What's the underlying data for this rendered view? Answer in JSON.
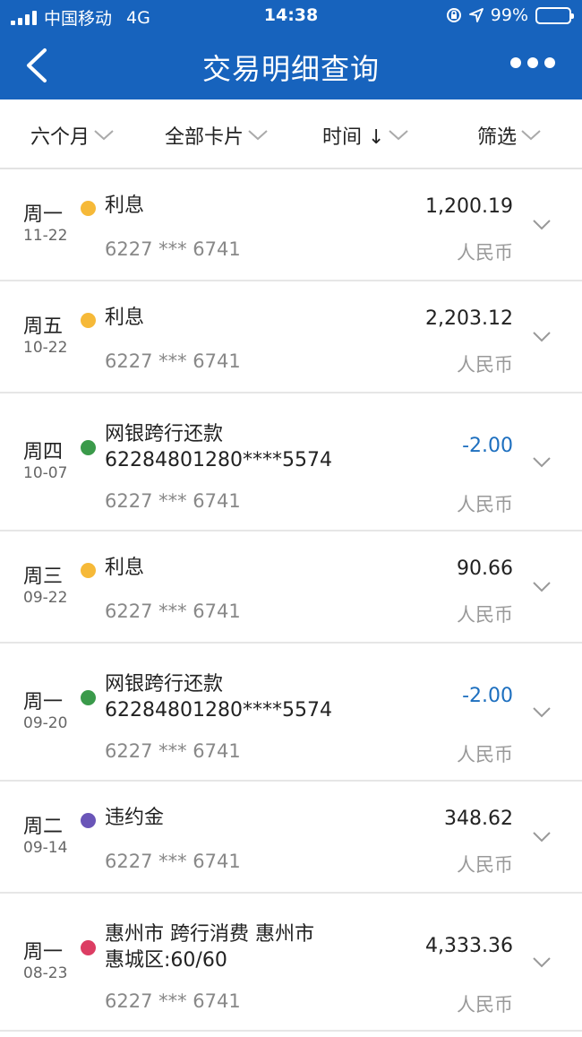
{
  "status_bar": {
    "carrier": "中国移动",
    "network": "4G",
    "time": "14:38",
    "battery": "99%",
    "battery_level": 0.99
  },
  "header": {
    "title": "交易明细查询",
    "back_icon": "chevron-left-icon",
    "more_icon": "more-dots-icon"
  },
  "filters": {
    "period": "六个月",
    "cards": "全部卡片",
    "sort": "时间 ↓",
    "filter": "筛选"
  },
  "transactions": [
    {
      "weekday": "周一",
      "date": "11-22",
      "dot_color": "#f6b938",
      "desc": "利息",
      "desc2": "",
      "card": "6227 *** 6741",
      "amount": "1,200.19",
      "negative": false,
      "currency": "人民币"
    },
    {
      "weekday": "周五",
      "date": "10-22",
      "dot_color": "#f6b938",
      "desc": "利息",
      "desc2": "",
      "card": "6227 *** 6741",
      "amount": "2,203.12",
      "negative": false,
      "currency": "人民币"
    },
    {
      "weekday": "周四",
      "date": "10-07",
      "dot_color": "#3a9a4a",
      "desc": "网银跨行还款",
      "desc2": "62284801280****5574",
      "card": "6227 *** 6741",
      "amount": "-2.00",
      "negative": true,
      "currency": "人民币"
    },
    {
      "weekday": "周三",
      "date": "09-22",
      "dot_color": "#f6b938",
      "desc": "利息",
      "desc2": "",
      "card": "6227 *** 6741",
      "amount": "90.66",
      "negative": false,
      "currency": "人民币"
    },
    {
      "weekday": "周一",
      "date": "09-20",
      "dot_color": "#3a9a4a",
      "desc": "网银跨行还款",
      "desc2": "62284801280****5574",
      "card": "6227 *** 6741",
      "amount": "-2.00",
      "negative": true,
      "currency": "人民币"
    },
    {
      "weekday": "周二",
      "date": "09-14",
      "dot_color": "#6a55b8",
      "desc": "违约金",
      "desc2": "",
      "card": "6227 *** 6741",
      "amount": "348.62",
      "negative": false,
      "currency": "人民币"
    },
    {
      "weekday": "周一",
      "date": "08-23",
      "dot_color": "#dc3d63",
      "desc": "惠州市 跨行消费 惠州市",
      "desc2": "惠城区:60/60",
      "card": "6227 *** 6741",
      "amount": "4,333.36",
      "negative": false,
      "currency": "人民币"
    }
  ],
  "colors": {
    "header_bg": "#1763bd",
    "negative_amount": "#1d6fbf"
  }
}
